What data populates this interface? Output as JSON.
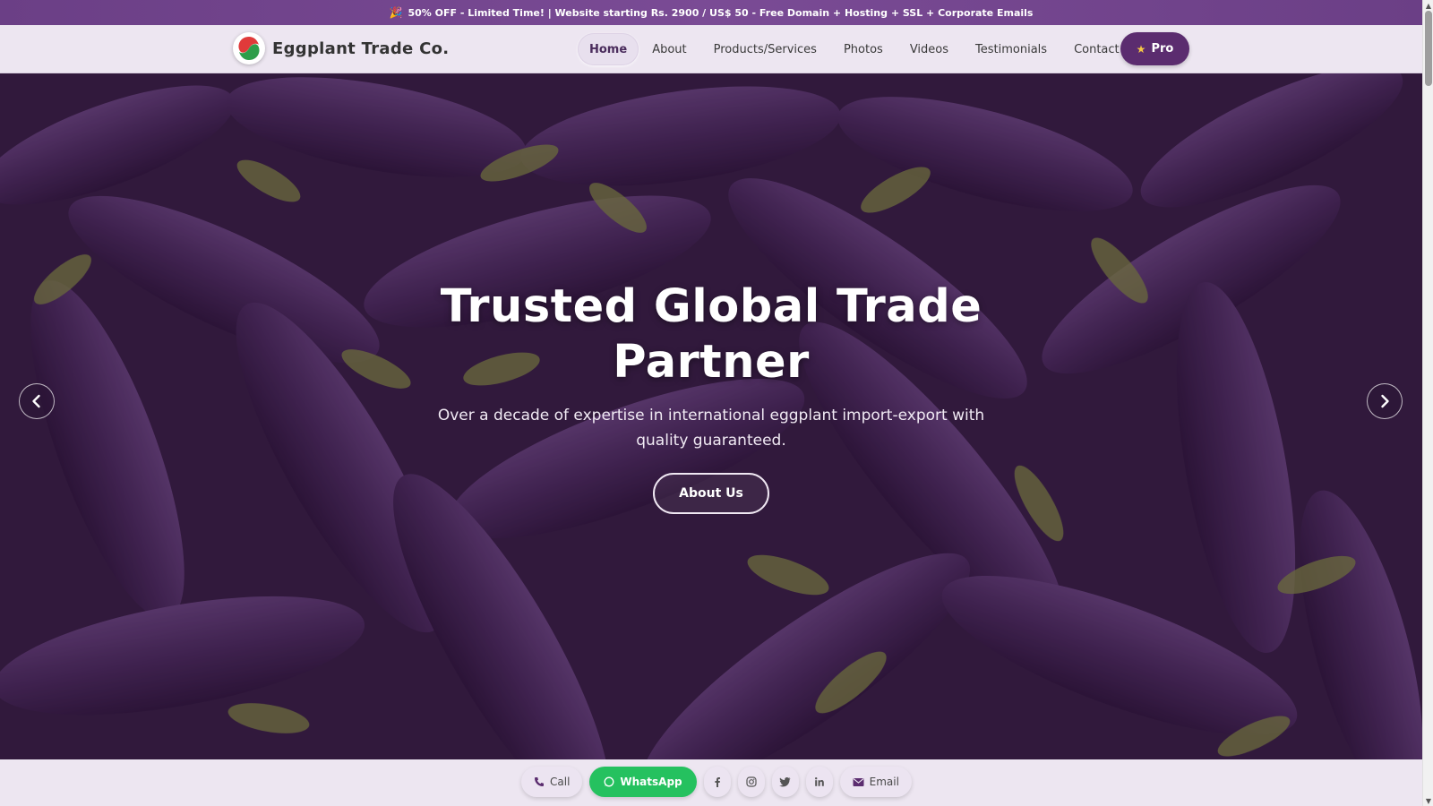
{
  "promo": {
    "icon": "party-popper-icon",
    "text": "50% OFF - Limited Time! | Website starting Rs. 2900 / US$ 50 - Free Domain + Hosting + SSL + Corporate Emails"
  },
  "header": {
    "brand_name": "Eggplant Trade Co.",
    "menu": [
      "Home",
      "About",
      "Products/Services",
      "Photos",
      "Videos",
      "Testimonials",
      "Contact"
    ],
    "active_item": "Home",
    "pro_label": "Pro",
    "pro_icon": "star-icon"
  },
  "hero": {
    "title": "Trusted Global Trade Partner",
    "subtitle": "Over a decade of expertise in international eggplant import-export with quality guaranteed.",
    "cta_label": "About Us"
  },
  "bottom_bar": {
    "call_label": "Call",
    "whatsapp_label": "WhatsApp",
    "email_label": "Email",
    "social_icons": [
      "facebook-icon",
      "instagram-icon",
      "twitter-icon",
      "linkedin-icon"
    ]
  },
  "colors": {
    "promo_bg": "#6b3f86",
    "nav_bg": "#ede6f1",
    "pro_bg": "#5b2c6f",
    "whatsapp": "#25c15f"
  }
}
